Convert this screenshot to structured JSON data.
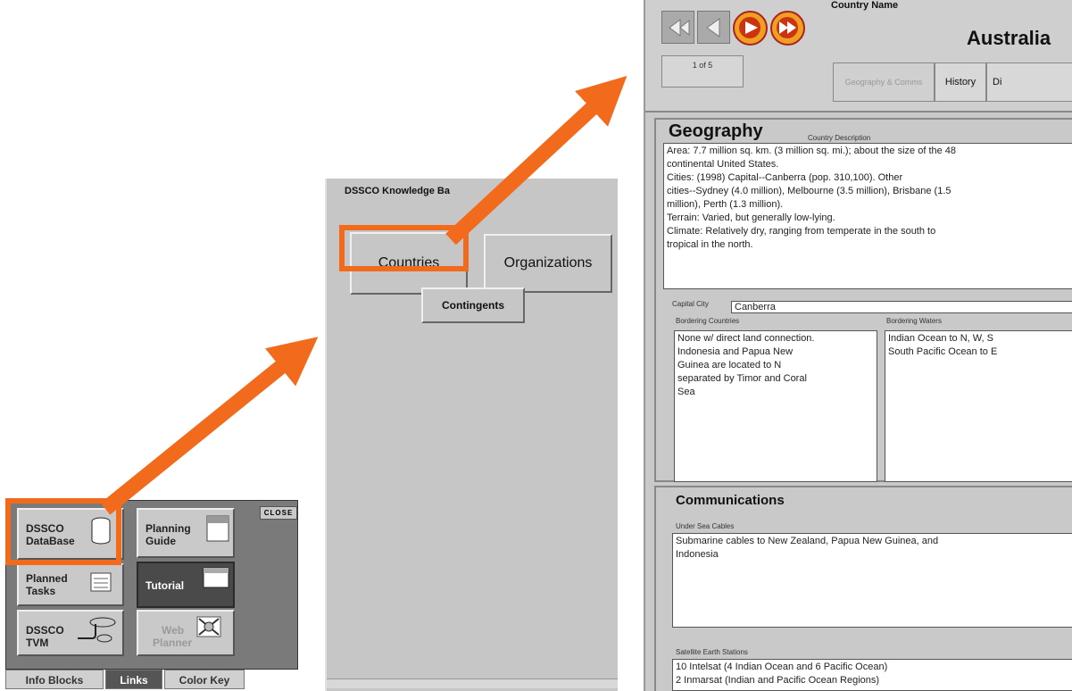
{
  "panel1": {
    "close_label": "CLOSE",
    "buttons": {
      "database": [
        "DSSCO",
        "DataBase"
      ],
      "planning": [
        "Planning",
        "Guide"
      ],
      "planned": [
        "Planned",
        "Tasks"
      ],
      "tutorial": [
        "Tutorial"
      ],
      "tvm": [
        "DSSCO",
        "TVM"
      ],
      "web": [
        "Web",
        "Planner"
      ]
    },
    "tabs": [
      "Info Blocks",
      "Links",
      "Color Key"
    ]
  },
  "panel2": {
    "title": "DSSCO Knowledge Ba",
    "buttons": {
      "countries": "Countries",
      "organizations": "Organizations",
      "contingents": "Contingents"
    }
  },
  "panel3": {
    "record_counter": "1 of 5",
    "country_name_label": "Country Name",
    "country_name": "Australia",
    "tabs": [
      "Geography & Comms",
      "History",
      "Di"
    ],
    "geography": {
      "heading": "Geography",
      "desc_label": "Country Description",
      "description_lines": [
        "Area: 7.7 million sq. km. (3 million sq. mi.); about the size of the 48",
        "continental United States.",
        "Cities: (1998) Capital--Canberra (pop. 310,100). Other",
        "cities--Sydney (4.0 million), Melbourne (3.5 million), Brisbane (1.5",
        "million), Perth (1.3 million).",
        "Terrain: Varied, but generally low-lying.",
        "Climate: Relatively dry, ranging from temperate in the south to",
        "tropical in the north."
      ],
      "capital_label": "Capital City",
      "capital_value": "Canberra",
      "bordering_countries_label": "Bordering Countries",
      "bordering_countries_lines": [
        "None w/ direct land connection.",
        "Indonesia and Papua New",
        "Guinea are located to N",
        "separated by Timor and Coral",
        "Sea"
      ],
      "bordering_waters_label": "Bordering Waters",
      "bordering_waters_lines": [
        "Indian Ocean to N, W, S",
        "South Pacific Ocean to E"
      ]
    },
    "communications": {
      "heading": "Communications",
      "cables_label": "Under Sea Cables",
      "cables_lines": [
        "Submarine cables to New Zealand, Papua New Guinea, and",
        "Indonesia"
      ],
      "satellite_label": "Satellite Earth Stations",
      "satellite_lines": [
        "10 Intelsat (4 Indian Ocean and 6 Pacific Ocean)",
        "2 Inmarsat (Indian and Pacific Ocean Regions)"
      ]
    }
  },
  "colors": {
    "accent": "#f26b1d",
    "panel_gray": "#c6c6c6",
    "dark_panel": "#7a7a7a"
  }
}
